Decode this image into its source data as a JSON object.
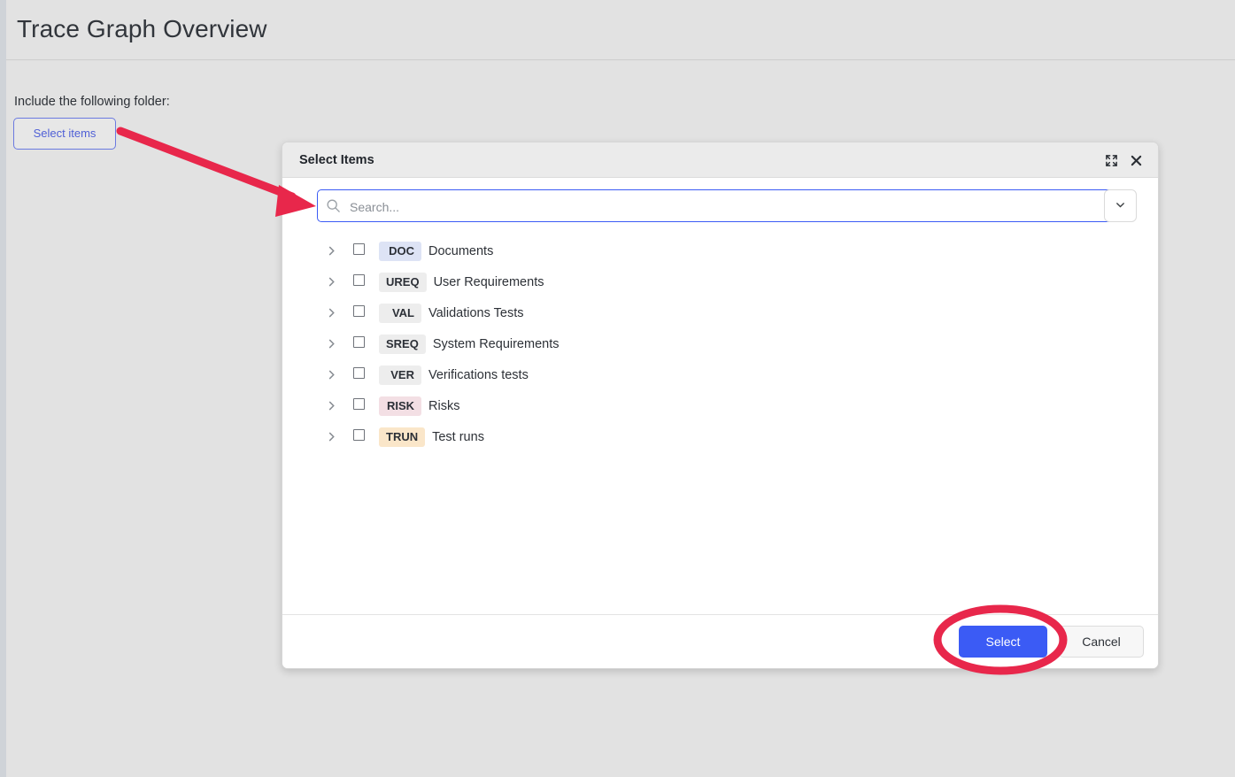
{
  "page": {
    "title": "Trace Graph Overview",
    "include_label": "Include the following folder:",
    "select_items_button": "Select items"
  },
  "dialog": {
    "title": "Select Items",
    "expand_icon": "expand-icon",
    "close_icon": "close-icon",
    "search": {
      "placeholder": "Search...",
      "value": "",
      "icon": "search-icon",
      "dropdown_icon": "chevron-down-icon"
    },
    "tree": {
      "expand_icon": "chevron-right-icon",
      "items": [
        {
          "badge": "DOC",
          "label": "Documents",
          "badge_color": "#dde3f5",
          "checked": false
        },
        {
          "badge": "UREQ",
          "label": "User Requirements",
          "badge_color": "#ededed",
          "checked": false
        },
        {
          "badge": "VAL",
          "label": "Validations Tests",
          "badge_color": "#ededed",
          "checked": false
        },
        {
          "badge": "SREQ",
          "label": "System Requirements",
          "badge_color": "#ededed",
          "checked": false
        },
        {
          "badge": "VER",
          "label": "Verifications tests",
          "badge_color": "#ededed",
          "checked": false
        },
        {
          "badge": "RISK",
          "label": "Risks",
          "badge_color": "#f3dfe4",
          "checked": false
        },
        {
          "badge": "TRUN",
          "label": "Test runs",
          "badge_color": "#fae6c9",
          "checked": false
        }
      ]
    },
    "footer": {
      "select_label": "Select",
      "cancel_label": "Cancel"
    }
  },
  "annotations": {
    "arrow_color": "#e8274b",
    "highlight_color": "#e8274b"
  },
  "colors": {
    "accent_blue": "#3b5bf5",
    "page_background": "#e2e2e2",
    "dialog_background": "#ffffff"
  }
}
